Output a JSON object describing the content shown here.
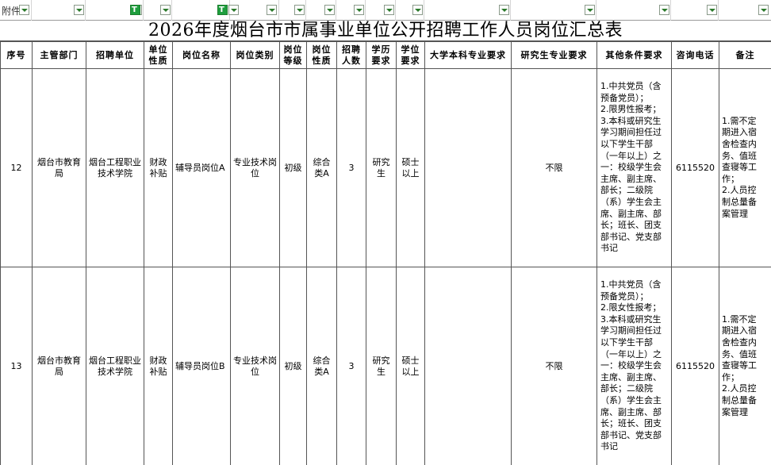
{
  "filter_row": {
    "attach_label": "附件",
    "colon": ":"
  },
  "title": "2026年度烟台市市属事业单位公开招聘工作人员岗位汇总表",
  "headers": {
    "seq": "序号",
    "dept": "主管部门",
    "unit": "招聘单位",
    "unit_nature": "单位性质",
    "post_name": "岗位名称",
    "post_type": "岗位类别",
    "post_level": "岗位等级",
    "post_nature": "岗位性质",
    "count": "招聘人数",
    "edu": "学历要求",
    "degree": "学位要求",
    "undergrad": "大学本科专业要求",
    "grad": "研究生专业要求",
    "other": "其他条件要求",
    "phone": "咨询电话",
    "remark": "备注"
  },
  "rows": [
    {
      "seq": "12",
      "dept": "烟台市教育局",
      "unit": "烟台工程职业技术学院",
      "unit_nature": "财政补贴",
      "post_name": "辅导员岗位A",
      "post_type": "专业技术岗位",
      "post_level": "初级",
      "post_nature": "综合类A",
      "count": "3",
      "edu": "研究生",
      "degree": "硕士以上",
      "undergrad": "",
      "grad": "不限",
      "other_lines": [
        "1.中共党员（含",
        "预备党员）；",
        "2.限男性报考；",
        "3.本科或研究生",
        "学习期间担任过",
        "以下学生干部",
        "（一年以上）之",
        "一：校级学生会",
        "主席、副主席、",
        "部长；二级院",
        "（系）学生会主",
        "席、副主席、部",
        "长；班长、团支",
        "部书记、党支部",
        "书记"
      ],
      "phone": "6115520",
      "remark_lines": [
        "1.需不定",
        "期进入宿",
        "舍检查内",
        "务、值班",
        "查寝等工",
        "作；",
        "2.人员控",
        "制总量备",
        "案管理"
      ]
    },
    {
      "seq": "13",
      "dept": "烟台市教育局",
      "unit": "烟台工程职业技术学院",
      "unit_nature": "财政补贴",
      "post_name": "辅导员岗位B",
      "post_type": "专业技术岗位",
      "post_level": "初级",
      "post_nature": "综合类A",
      "count": "3",
      "edu": "研究生",
      "degree": "硕士以上",
      "undergrad": "",
      "grad": "不限",
      "other_lines": [
        "1.中共党员（含",
        "预备党员）；",
        "2.限女性报考；",
        "3.本科或研究生",
        "学习期间担任过",
        "以下学生干部",
        "（一年以上）之",
        "一：校级学生会",
        "主席、副主席、",
        "部长；二级院",
        "（系）学生会主",
        "席、副主席、部",
        "长；班长、团支",
        "部书记、党支部",
        "书记"
      ],
      "phone": "6115520",
      "remark_lines": [
        "1.需不定",
        "期进入宿",
        "舍检查内",
        "务、值班",
        "查寝等工",
        "作；",
        "2.人员控",
        "制总量备",
        "案管理"
      ]
    }
  ],
  "colors": {
    "filter_active": "#1e9e3e",
    "border": "#555555"
  }
}
